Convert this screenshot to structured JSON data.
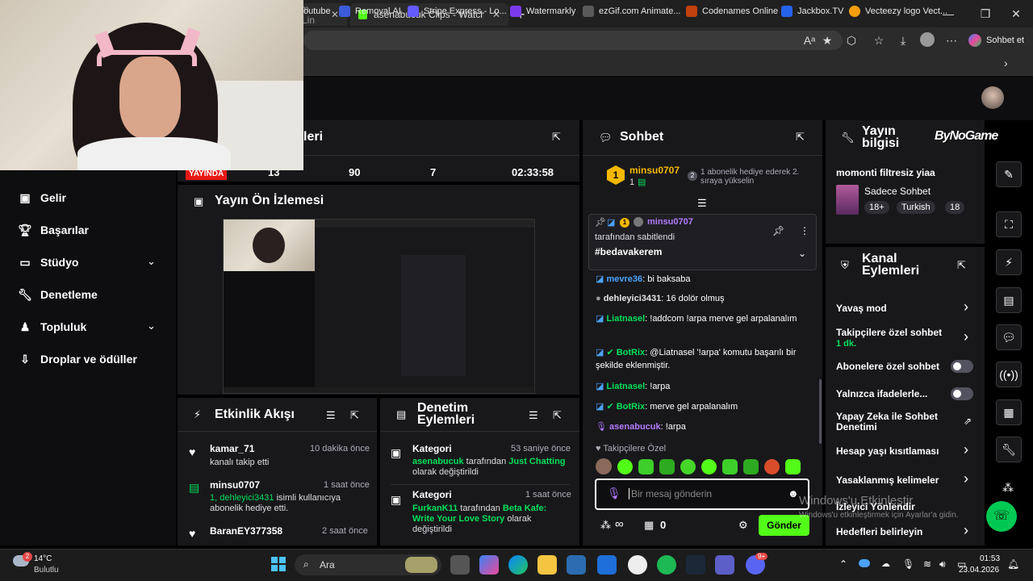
{
  "browser": {
    "tabs": [
      {
        "title": "im (Lin"
      },
      {
        "title": "asenabucuk Clips - Watch Live on"
      }
    ],
    "copilot_label": "Sohbet et",
    "bookmarks": [
      "outube",
      "Removal.AI",
      "Stripe Express - Lo...",
      "Watermarkly",
      "ezGif.com Animate...",
      "Codenames Online",
      "Jackbox.TV",
      "Vecteezy logo Vect..."
    ]
  },
  "nav": {
    "items": [
      {
        "label": "Gelir",
        "icon": "money-icon"
      },
      {
        "label": "Başarılar",
        "icon": "trophy-icon"
      },
      {
        "label": "Stüdyo",
        "icon": "studio-icon"
      },
      {
        "label": "Denetleme",
        "icon": "wrench-icon"
      },
      {
        "label": "Topluluk",
        "icon": "community-icon"
      },
      {
        "label": "Droplar ve ödüller",
        "icon": "drops-icon"
      }
    ]
  },
  "stats": {
    "title_partial": "leri",
    "live_badge": "YAYINDA",
    "values": [
      "13",
      "90",
      "7",
      "02:33:58"
    ]
  },
  "preview": {
    "title": "Yayın Ön İzlemesi"
  },
  "activity": {
    "title": "Etkinlik Akışı",
    "items": [
      {
        "user": "kamar_71",
        "time": "10 dakika önce",
        "desc": "kanalı takip etti",
        "type": "follow"
      },
      {
        "user": "minsu0707",
        "time": "1 saat önce",
        "desc_highlight": "1, dehleyici3431",
        "desc": " isimli kullanıcıya abonelik hediye etti.",
        "type": "gift"
      },
      {
        "user": "BaranEY377358",
        "time": "2 saat önce",
        "type": "follow"
      }
    ]
  },
  "modactions": {
    "title": "Denetim Eylemleri",
    "items": [
      {
        "title": "Kategori",
        "time": "53 saniye önce",
        "user": "asenabucuk",
        "mid": " tarafından ",
        "value": "Just Chatting",
        "tail": " olarak değiştirildi"
      },
      {
        "title": "Kategori",
        "time": "1 saat önce",
        "user": "FurkanK11",
        "mid": " tarafından ",
        "value": "Beta Kafe: Write Your Love Story",
        "tail": " olarak değiştirildi"
      }
    ]
  },
  "chat": {
    "title": "Sohbet",
    "leader": {
      "user": "minsu0707",
      "count": "1",
      "rank": "1",
      "hint": "1 abonelik hediye ederek 2. sıraya yükselin"
    },
    "pinned": {
      "user": "minsu0707",
      "by": "tarafından sabitlendi",
      "text": "#bedavakerem"
    },
    "messages": [
      {
        "user": "mevre36",
        "text": " bi baksaba",
        "color": "#4ba3ff"
      },
      {
        "user": "dehleyici3431",
        "text": " 16 dolör olmuş",
        "color": "#e5e5e5"
      },
      {
        "user": "Liatnasel",
        "text": " !addcom !arpa merve gel arpalanalım",
        "color": "#00e05a"
      },
      {
        "user": "BotRix",
        "text": " @Liatnasel '!arpa' komutu başarılı bir şekilde eklenmiştir.",
        "color": "#00e05a"
      },
      {
        "user": "Liatnasel",
        "text": " !arpa",
        "color": "#00e05a"
      },
      {
        "user": "BotRix",
        "text": " merve gel arpalanalım",
        "color": "#00e05a"
      },
      {
        "user": "asenabucuk",
        "text": " !arpa",
        "color": "#b47bff"
      }
    ],
    "followers_only": "Takipçilere Özel",
    "input_placeholder": "Bir mesaj gönderin",
    "points": "∞",
    "gift_count": "0",
    "send_label": "Gönder"
  },
  "streaminfo": {
    "title": "Yayın bilgisi",
    "stream_title": "momonti filtresiz yiaa",
    "category": "Sadece Sohbet",
    "tags": [
      "18+",
      "Turkish",
      "18"
    ]
  },
  "channel": {
    "title": "Kanal Eylemleri",
    "items": [
      {
        "label": "Yavaş mod",
        "control": "chevron"
      },
      {
        "label": "Takipçilere özel sohbet",
        "sub": "1 dk.",
        "control": "chevron"
      },
      {
        "label": "Abonelere özel sohbet",
        "control": "toggle"
      },
      {
        "label": "Yalnızca ifadelerle...",
        "control": "toggle"
      },
      {
        "label": "Yapay Zeka ile Sohbet Denetimi",
        "control": "external"
      },
      {
        "label": "Hesap yaşı kısıtlaması",
        "control": "chevron"
      },
      {
        "label": "Yasaklanmış kelimeler",
        "control": "chevron"
      },
      {
        "label": "İzleyici Yönlendir",
        "control": "none"
      },
      {
        "label": "Hedefleri belirleyin",
        "control": "chevron"
      }
    ]
  },
  "watermark": {
    "logo": "ByNoGame"
  },
  "activation": {
    "title": "Windows'u Etkinleştir",
    "sub": "Windows'u etkinleştirmek için Ayarlar'a gidin."
  },
  "taskbar": {
    "weather_temp": "14°C",
    "weather_desc": "Bulutlu",
    "weather_badge": "2",
    "search": "Ara",
    "time": "01:53",
    "date": "23.04.2026",
    "discord_badge": "9+"
  }
}
